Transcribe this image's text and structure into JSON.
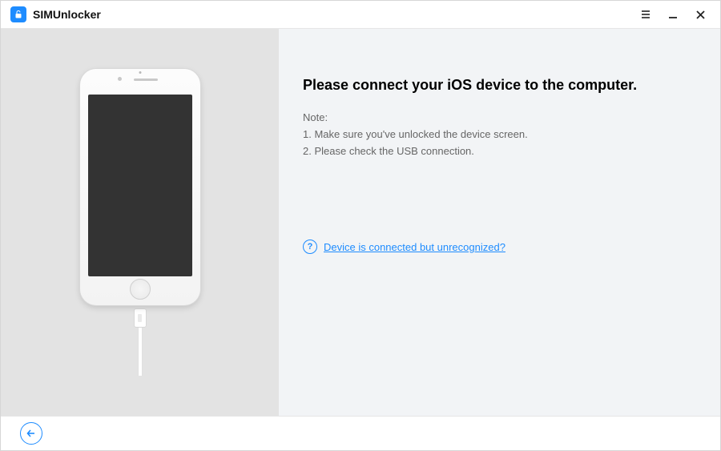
{
  "header": {
    "app_title": "SIMUnlocker"
  },
  "main": {
    "heading": "Please connect your iOS device to the computer.",
    "note_label": "Note:",
    "note_1": "1. Make sure you've unlocked the device screen.",
    "note_2": "2. Please check the USB connection.",
    "help_link": "Device is connected but unrecognized?"
  }
}
